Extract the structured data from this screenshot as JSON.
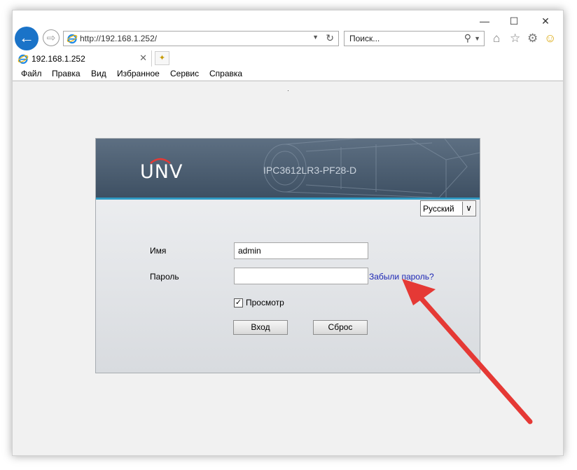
{
  "browser": {
    "window_controls": [
      "—",
      "☐",
      "✕"
    ],
    "address": "http://192.168.1.252/",
    "search_placeholder": "Поиск...",
    "tab_title": "192.168.1.252",
    "menu": [
      "Файл",
      "Правка",
      "Вид",
      "Избранное",
      "Сервис",
      "Справка"
    ]
  },
  "login": {
    "logo": "UNV",
    "model": "IPC3612LR3-PF28-D",
    "language": "Русский",
    "username_label": "Имя",
    "username_value": "admin",
    "password_label": "Пароль",
    "password_value": "",
    "forgot_link": "Забыли пароль?",
    "preview_label": "Просмотр",
    "preview_checked": true,
    "login_button": "Вход",
    "reset_button": "Сброс"
  },
  "colors": {
    "header_bg": "#4a5c6f",
    "accent_line": "#2f9bc4",
    "link": "#1d27b4",
    "annotation_arrow": "#e53935",
    "ie_back": "#1a73c8"
  }
}
